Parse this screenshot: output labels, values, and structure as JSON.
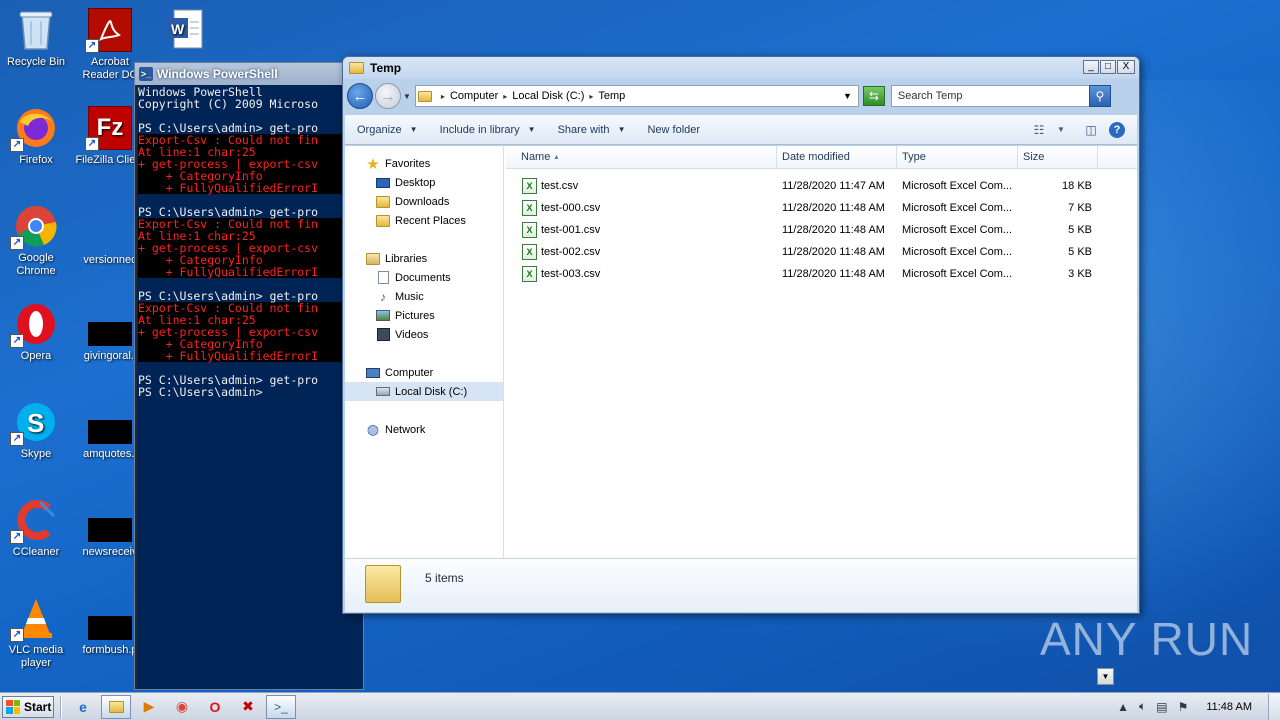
{
  "desktop": {
    "icons": [
      {
        "label": "Recycle Bin",
        "icon": "recycle-bin-icon"
      },
      {
        "label": "Acrobat Reader DC",
        "icon": "acrobat-reader-icon"
      },
      {
        "label": "",
        "icon": "word-document-icon"
      },
      {
        "label": "Firefox",
        "icon": "firefox-icon"
      },
      {
        "label": "FileZilla Client",
        "icon": "filezilla-icon"
      },
      {
        "label": "Google Chrome",
        "icon": "chrome-icon"
      },
      {
        "label": "versionnec",
        "icon": "file-thumbnail-icon"
      },
      {
        "label": "Opera",
        "icon": "opera-icon"
      },
      {
        "label": "givingoral.j",
        "icon": "file-thumbnail-icon"
      },
      {
        "label": "Skype",
        "icon": "skype-icon"
      },
      {
        "label": "amquotes.j",
        "icon": "file-thumbnail-icon"
      },
      {
        "label": "CCleaner",
        "icon": "ccleaner-icon"
      },
      {
        "label": "newsreceiv",
        "icon": "file-thumbnail-icon"
      },
      {
        "label": "VLC media player",
        "icon": "vlc-icon"
      },
      {
        "label": "formbush.p",
        "icon": "file-thumbnail-icon"
      }
    ]
  },
  "powershell": {
    "title": "Windows PowerShell",
    "lines": [
      {
        "text": "Windows PowerShell",
        "kind": "white"
      },
      {
        "text": "Copyright (C) 2009 Microso",
        "kind": "white"
      },
      {
        "text": "",
        "kind": "blank"
      },
      {
        "text": "PS C:\\Users\\admin> get-pro",
        "kind": "white"
      },
      {
        "text": "Export-Csv : Could not fin",
        "kind": "red"
      },
      {
        "text": "At line:1 char:25",
        "kind": "red"
      },
      {
        "text": "+ get-process | export-csv",
        "kind": "red"
      },
      {
        "text": "    + CategoryInfo",
        "kind": "red"
      },
      {
        "text": "    + FullyQualifiedErrorI",
        "kind": "red"
      },
      {
        "text": "",
        "kind": "blank"
      },
      {
        "text": "PS C:\\Users\\admin> get-pro",
        "kind": "white"
      },
      {
        "text": "Export-Csv : Could not fin",
        "kind": "red"
      },
      {
        "text": "At line:1 char:25",
        "kind": "red"
      },
      {
        "text": "+ get-process | export-csv",
        "kind": "red"
      },
      {
        "text": "    + CategoryInfo",
        "kind": "red"
      },
      {
        "text": "    + FullyQualifiedErrorI",
        "kind": "red"
      },
      {
        "text": "",
        "kind": "blank"
      },
      {
        "text": "PS C:\\Users\\admin> get-pro",
        "kind": "white"
      },
      {
        "text": "Export-Csv : Could not fin",
        "kind": "red"
      },
      {
        "text": "At line:1 char:25",
        "kind": "red"
      },
      {
        "text": "+ get-process | export-csv",
        "kind": "red"
      },
      {
        "text": "    + CategoryInfo",
        "kind": "red"
      },
      {
        "text": "    + FullyQualifiedErrorI",
        "kind": "red"
      },
      {
        "text": "",
        "kind": "blank"
      },
      {
        "text": "PS C:\\Users\\admin> get-pro",
        "kind": "white"
      },
      {
        "text": "PS C:\\Users\\admin>",
        "kind": "white"
      }
    ]
  },
  "explorer": {
    "title": "Temp",
    "window_buttons": {
      "minimize": "_",
      "maximize": "□",
      "close": "X"
    },
    "breadcrumb": [
      "Computer",
      "Local Disk (C:)",
      "Temp"
    ],
    "search_placeholder": "Search Temp",
    "toolbar": {
      "organize": "Organize",
      "include_in_library": "Include in library",
      "share_with": "Share with",
      "new_folder": "New folder"
    },
    "nav": {
      "favorites": "Favorites",
      "desktop": "Desktop",
      "downloads": "Downloads",
      "recent_places": "Recent Places",
      "libraries": "Libraries",
      "documents": "Documents",
      "music": "Music",
      "pictures": "Pictures",
      "videos": "Videos",
      "computer": "Computer",
      "local_disk": "Local Disk (C:)",
      "network": "Network"
    },
    "columns": {
      "name": "Name",
      "date_modified": "Date modified",
      "type": "Type",
      "size": "Size"
    },
    "files": [
      {
        "name": "test.csv",
        "date": "11/28/2020 11:47 AM",
        "type": "Microsoft Excel Com...",
        "size": "18 KB"
      },
      {
        "name": "test-000.csv",
        "date": "11/28/2020 11:48 AM",
        "type": "Microsoft Excel Com...",
        "size": "7 KB"
      },
      {
        "name": "test-001.csv",
        "date": "11/28/2020 11:48 AM",
        "type": "Microsoft Excel Com...",
        "size": "5 KB"
      },
      {
        "name": "test-002.csv",
        "date": "11/28/2020 11:48 AM",
        "type": "Microsoft Excel Com...",
        "size": "5 KB"
      },
      {
        "name": "test-003.csv",
        "date": "11/28/2020 11:48 AM",
        "type": "Microsoft Excel Com...",
        "size": "3 KB"
      }
    ],
    "item_count": "5 items"
  },
  "watermark": "ANY RUN",
  "taskbar": {
    "start_label": "Start",
    "clock": "11:48 AM"
  }
}
